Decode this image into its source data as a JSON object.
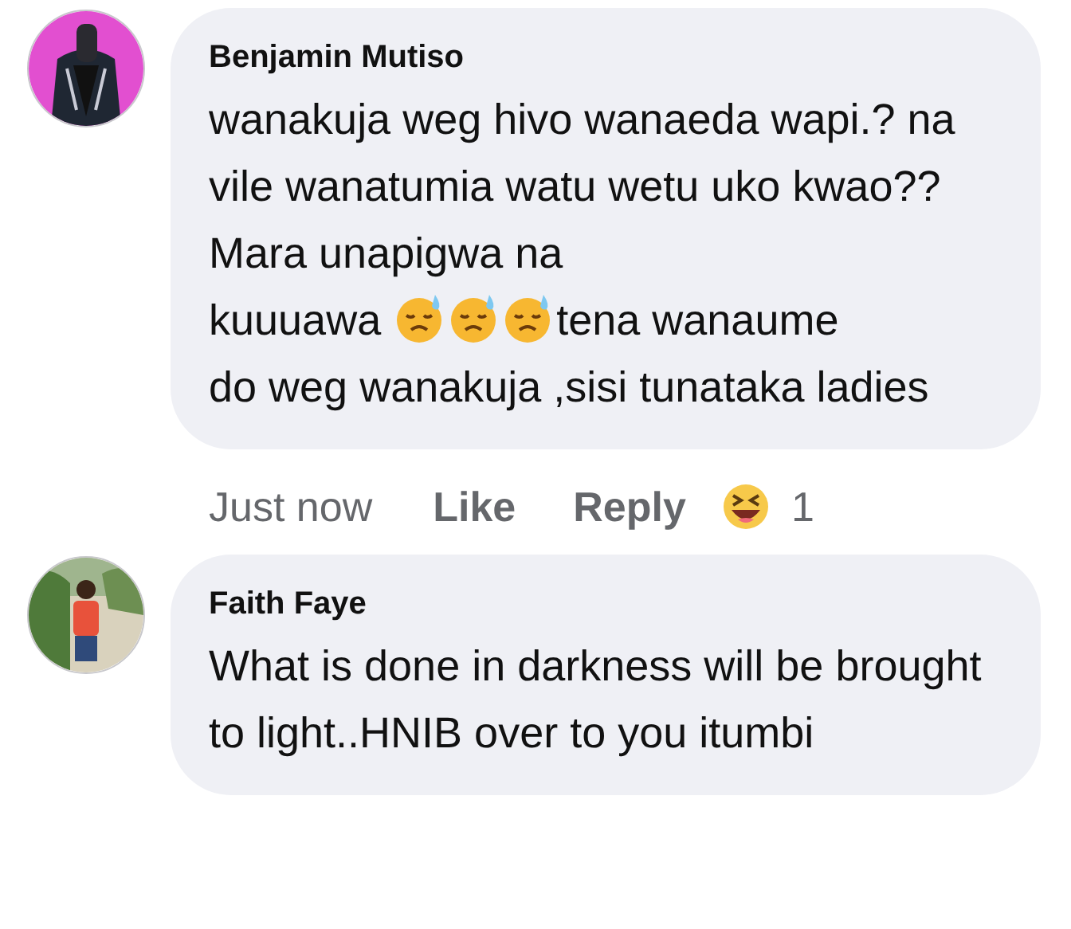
{
  "comments": [
    {
      "author": "Benjamin Mutiso",
      "avatar": {
        "kind": "picture"
      },
      "body": [
        {
          "kind": "text",
          "text": "wanakuja weg hivo wanaeda wapi.? na vile wanatumia watu wetu uko kwao?? Mara unapigwa na"
        },
        {
          "kind": "text",
          "text": "kuuuawa"
        },
        {
          "kind": "emoji"
        },
        {
          "kind": "emoji"
        },
        {
          "kind": "emoji"
        },
        {
          "kind": "text",
          "text": "tena wanaume"
        },
        {
          "kind": "text",
          "text": "do weg wanakuja ,sisi tunataka ladies"
        }
      ],
      "meta": {
        "time": "Just now",
        "like": "Like",
        "reply": "Reply",
        "reaction_count": "1"
      }
    },
    {
      "author": "Faith Faye",
      "avatar": {
        "kind": "picture"
      },
      "body": [
        {
          "kind": "text",
          "text": "What is done in darkness will be brought to light..HNIB over to you itumbi"
        }
      ]
    }
  ]
}
